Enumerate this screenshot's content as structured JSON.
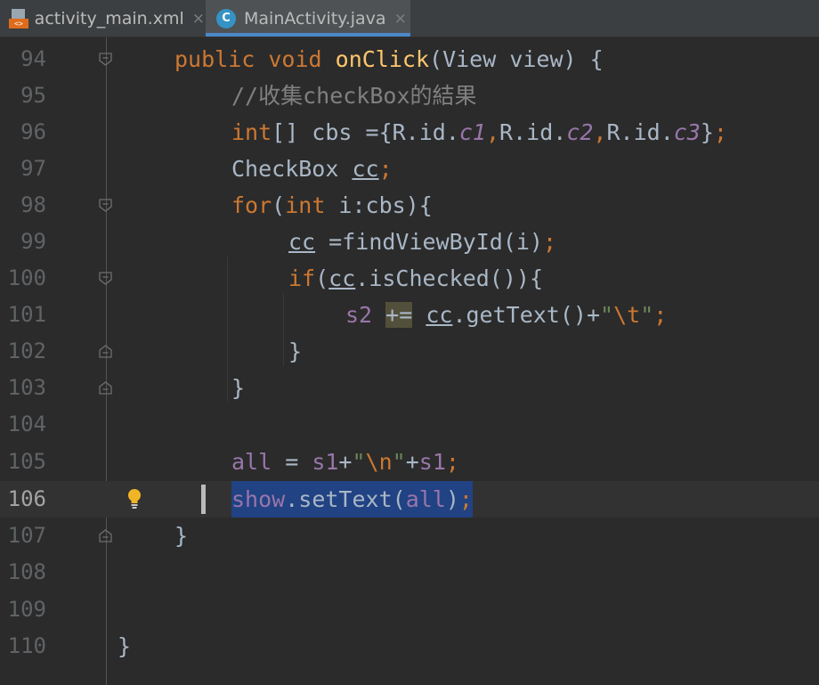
{
  "tabs": [
    {
      "label": "activity_main.xml",
      "icon": "xml-file-icon",
      "active": false
    },
    {
      "label": "MainActivity.java",
      "icon": "java-class-icon",
      "active": true,
      "icon_letter": "C"
    }
  ],
  "editor": {
    "current_line": "106",
    "lines": [
      {
        "n": "94"
      },
      {
        "n": "95"
      },
      {
        "n": "96"
      },
      {
        "n": "97"
      },
      {
        "n": "98"
      },
      {
        "n": "99"
      },
      {
        "n": "100"
      },
      {
        "n": "101"
      },
      {
        "n": "102"
      },
      {
        "n": "103"
      },
      {
        "n": "104"
      },
      {
        "n": "105"
      },
      {
        "n": "106"
      },
      {
        "n": "107"
      },
      {
        "n": "108"
      },
      {
        "n": "109"
      },
      {
        "n": "110"
      }
    ],
    "code": {
      "l94": [
        "public",
        " ",
        "void",
        " ",
        "onClick",
        "(View view) {"
      ],
      "l95": [
        "//收集checkBox的結果"
      ],
      "l96": [
        "int",
        "[] cbs ={R.id.",
        "c1",
        ",",
        "R.id.",
        "c2",
        ",",
        "R.id.",
        "c3",
        "}",
        ";"
      ],
      "l97": [
        "CheckBox ",
        "cc",
        ";"
      ],
      "l98": [
        "for",
        "(",
        "int",
        " i:cbs){"
      ],
      "l99": [
        "cc",
        " =findViewById(i)",
        ";"
      ],
      "l100": [
        "if",
        "(",
        "cc",
        ".isChecked()){"
      ],
      "l101": [
        "s2",
        " ",
        "+=",
        " ",
        "cc",
        ".getText()+",
        "\"",
        "\\t",
        "\"",
        ";"
      ],
      "l102": [
        "}"
      ],
      "l103": [
        "}"
      ],
      "l105": [
        "all",
        " = ",
        "s1",
        "+",
        "\"",
        "\\n",
        "\"",
        "+",
        "s1",
        ";"
      ],
      "l106": [
        "show",
        ".setText(",
        "all",
        ")",
        ";"
      ],
      "l107": [
        "}"
      ],
      "l110": [
        "}"
      ]
    }
  },
  "colors": {
    "background": "#2b2b2b",
    "keyword": "#cc7832",
    "function": "#ffc66d",
    "field": "#9876aa",
    "string": "#6a8759",
    "comment": "#808080",
    "selection": "#214283"
  }
}
